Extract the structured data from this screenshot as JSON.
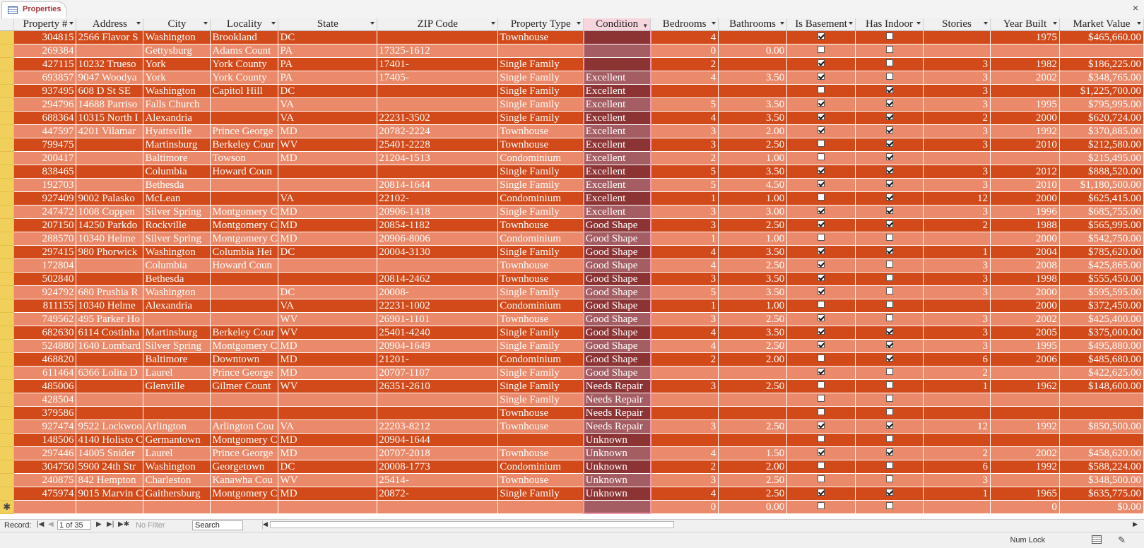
{
  "tab": {
    "title": "Properties",
    "close": "×"
  },
  "columns": [
    "Property #",
    "Address",
    "City",
    "Locality",
    "State",
    "ZIP Code",
    "Property Type",
    "Condition",
    "Bedrooms",
    "Bathrooms",
    "Is Basement",
    "Has Indoor",
    "Stories",
    "Year Built",
    "Market Value"
  ],
  "rows": [
    [
      "304815",
      "2566 Flavor S",
      "Washington",
      "Brookland",
      "DC",
      "",
      "Townhouse",
      "",
      "4",
      "",
      true,
      false,
      "",
      "1975",
      "$465,660.00"
    ],
    [
      "269384",
      "",
      "Gettysburg",
      "Adams Count",
      "PA",
      "17325-1612",
      "",
      "",
      "0",
      "0.00",
      false,
      false,
      "",
      "",
      ""
    ],
    [
      "427115",
      "10232 Trueso",
      "York",
      "York County",
      "PA",
      "17401-",
      "Single Family",
      "",
      "2",
      "",
      true,
      false,
      "3",
      "1982",
      "$186,225.00"
    ],
    [
      "693857",
      "9047 Woodya",
      "York",
      "York County",
      "PA",
      "17405-",
      "Single Family",
      "Excellent",
      "4",
      "3.50",
      true,
      false,
      "3",
      "2002",
      "$348,765.00"
    ],
    [
      "937495",
      "608 D St SE",
      "Washington",
      "Capitol Hill",
      "DC",
      "",
      "Single Family",
      "Excellent",
      "",
      "",
      false,
      true,
      "3",
      "",
      "$1,225,700.00"
    ],
    [
      "294796",
      "14688 Parriso",
      "Falls Church",
      "",
      "VA",
      "",
      "Single Family",
      "Excellent",
      "5",
      "3.50",
      true,
      true,
      "3",
      "1995",
      "$795,995.00"
    ],
    [
      "688364",
      "10315 North I",
      "Alexandria",
      "",
      "VA",
      "22231-3502",
      "Single Family",
      "Excellent",
      "4",
      "3.50",
      true,
      true,
      "2",
      "2000",
      "$620,724.00"
    ],
    [
      "447597",
      "4201 Vilamar",
      "Hyattsville",
      "Prince George",
      "MD",
      "20782-2224",
      "Townhouse",
      "Excellent",
      "3",
      "2.00",
      true,
      true,
      "3",
      "1992",
      "$370,885.00"
    ],
    [
      "799475",
      "",
      "Martinsburg",
      "Berkeley Cour",
      "WV",
      "25401-2228",
      "Townhouse",
      "Excellent",
      "3",
      "2.50",
      false,
      true,
      "3",
      "2010",
      "$212,580.00"
    ],
    [
      "200417",
      "",
      "Baltimore",
      "Towson",
      "MD",
      "21204-1513",
      "Condominium",
      "Excellent",
      "2",
      "1.00",
      false,
      true,
      "",
      "",
      "$215,495.00"
    ],
    [
      "838465",
      "",
      "Columbia",
      "Howard Coun",
      "",
      "",
      "Single Family",
      "Excellent",
      "5",
      "3.50",
      true,
      true,
      "3",
      "2012",
      "$888,520.00"
    ],
    [
      "192703",
      "",
      "Bethesda",
      "",
      "",
      "20814-1644",
      "Single Family",
      "Excellent",
      "5",
      "4.50",
      true,
      true,
      "3",
      "2010",
      "$1,180,500.00"
    ],
    [
      "927409",
      "9002 Palasko",
      "McLean",
      "",
      "VA",
      "22102-",
      "Condominium",
      "Excellent",
      "1",
      "1.00",
      false,
      true,
      "12",
      "2000",
      "$625,415.00"
    ],
    [
      "247472",
      "1008 Coppen",
      "Silver Spring",
      "Montgomery C",
      "MD",
      "20906-1418",
      "Single Family",
      "Excellent",
      "3",
      "3.00",
      true,
      true,
      "3",
      "1996",
      "$685,755.00"
    ],
    [
      "207150",
      "14250 Parkdo",
      "Rockville",
      "Montgomery C",
      "MD",
      "20854-1182",
      "Townhouse",
      "Good Shape",
      "3",
      "2.50",
      true,
      true,
      "2",
      "1988",
      "$565,995.00"
    ],
    [
      "288570",
      "10340 Helme",
      "Silver Spring",
      "Montgomery C",
      "MD",
      "20906-8006",
      "Condominium",
      "Good Shape",
      "1",
      "1.00",
      false,
      false,
      "",
      "2000",
      "$542,750.00"
    ],
    [
      "297415",
      "980 Phorwick",
      "Washington",
      "Columbia Hei",
      "DC",
      "20004-3130",
      "Single Family",
      "Good Shape",
      "4",
      "3.50",
      true,
      true,
      "1",
      "2004",
      "$785,620.00"
    ],
    [
      "172804",
      "",
      "Columbia",
      "Howard Coun",
      "",
      "",
      "Townhouse",
      "Good Shape",
      "4",
      "2.50",
      true,
      false,
      "3",
      "2008",
      "$425,865.00"
    ],
    [
      "502840",
      "",
      "Bethesda",
      "",
      "",
      "20814-2462",
      "Townhouse",
      "Good Shape",
      "3",
      "3.50",
      true,
      false,
      "3",
      "1998",
      "$555,450.00"
    ],
    [
      "924792",
      "680 Prushia R",
      "Washington",
      "",
      "DC",
      "20008-",
      "Single Family",
      "Good Shape",
      "5",
      "3.50",
      true,
      false,
      "3",
      "2000",
      "$595,595.00"
    ],
    [
      "811155",
      "10340 Helme",
      "Alexandria",
      "",
      "VA",
      "22231-1002",
      "Condominium",
      "Good Shape",
      "1",
      "1.00",
      false,
      false,
      "",
      "2000",
      "$372,450.00"
    ],
    [
      "749562",
      "495 Parker Ho",
      "",
      "",
      "WV",
      "26901-1101",
      "Townhouse",
      "Good Shape",
      "3",
      "2.50",
      true,
      false,
      "3",
      "2002",
      "$425,400.00"
    ],
    [
      "682630",
      "6114 Costinha",
      "Martinsburg",
      "Berkeley Cour",
      "WV",
      "25401-4240",
      "Single Family",
      "Good Shape",
      "4",
      "3.50",
      true,
      true,
      "3",
      "2005",
      "$375,000.00"
    ],
    [
      "524880",
      "1640 Lombard",
      "Silver Spring",
      "Montgomery C",
      "MD",
      "20904-1649",
      "Single Family",
      "Good Shape",
      "4",
      "2.50",
      true,
      true,
      "3",
      "1995",
      "$495,880.00"
    ],
    [
      "468820",
      "",
      "Baltimore",
      "Downtown",
      "MD",
      "21201-",
      "Condominium",
      "Good Shape",
      "2",
      "2.00",
      false,
      true,
      "6",
      "2006",
      "$485,680.00"
    ],
    [
      "611464",
      "6366 Lolita D",
      "Laurel",
      "Prince George",
      "MD",
      "20707-1107",
      "Single Family",
      "Good Shape",
      "",
      "",
      true,
      false,
      "2",
      "",
      "$422,625.00"
    ],
    [
      "485006",
      "",
      "Glenville",
      "Gilmer Count",
      "WV",
      "26351-2610",
      "Single Family",
      "Needs Repair",
      "3",
      "2.50",
      false,
      false,
      "1",
      "1962",
      "$148,600.00"
    ],
    [
      "428504",
      "",
      "",
      "",
      "",
      "",
      "Single Family",
      "Needs Repair",
      "",
      "",
      false,
      false,
      "",
      "",
      ""
    ],
    [
      "379586",
      "",
      "",
      "",
      "",
      "",
      "Townhouse",
      "Needs Repair",
      "",
      "",
      false,
      false,
      "",
      "",
      ""
    ],
    [
      "927474",
      "9522 Lockwoo",
      "Arlington",
      "Arlington Cou",
      "VA",
      "22203-8212",
      "Townhouse",
      "Needs Repair",
      "3",
      "2.50",
      true,
      true,
      "12",
      "1992",
      "$850,500.00"
    ],
    [
      "148506",
      "4140 Holisto C",
      "Germantown",
      "Montgomery C",
      "MD",
      "20904-1644",
      "",
      "Unknown",
      "",
      "",
      false,
      false,
      "",
      "",
      ""
    ],
    [
      "297446",
      "14005 Snider",
      "Laurel",
      "Prince George",
      "MD",
      "20707-2018",
      "Townhouse",
      "Unknown",
      "4",
      "1.50",
      true,
      true,
      "2",
      "2002",
      "$458,620.00"
    ],
    [
      "304750",
      "5900 24th Str",
      "Washington",
      "Georgetown",
      "DC",
      "20008-1773",
      "Condominium",
      "Unknown",
      "2",
      "2.00",
      false,
      false,
      "6",
      "1992",
      "$588,224.00"
    ],
    [
      "240875",
      "842 Hempton",
      "Charleston",
      "Kanawha Cou",
      "WV",
      "25414-",
      "Townhouse",
      "Unknown",
      "3",
      "2.50",
      false,
      false,
      "3",
      "",
      "$348,500.00"
    ],
    [
      "475974",
      "9015 Marvin C",
      "Gaithersburg",
      "Montgomery C",
      "MD",
      "20872-",
      "Single Family",
      "Unknown",
      "4",
      "2.50",
      true,
      true,
      "1",
      "1965",
      "$635,775.00"
    ]
  ],
  "new_row": [
    "",
    "",
    "",
    "",
    "",
    "",
    "",
    "",
    "0",
    "0.00",
    false,
    false,
    "",
    "0",
    "$0.00"
  ],
  "new_row_marker": "✱",
  "navigation": {
    "record_label": "Record:",
    "record_position": "1 of 35",
    "first": "|◀",
    "prev": "◀",
    "next": "▶",
    "last": "▶|",
    "new": "▶✱",
    "no_filter": "No Filter",
    "search_placeholder": "Search"
  },
  "status": {
    "num_lock": "Num Lock"
  },
  "colors": {
    "dark_row": "#d24a1a",
    "light_row": "#eb8a6a",
    "selected_column_dark": "#8c3434",
    "selected_column_light": "#a45e63"
  }
}
